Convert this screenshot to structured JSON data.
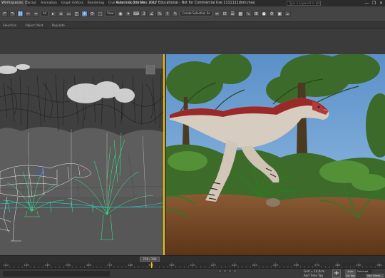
{
  "window": {
    "workspace": "Workspaces: Default",
    "title": "Autodesk 3ds Max 2017 Educational - Not for Commercial Use   1111111dnm.max",
    "search_placeholder": "Type a keyword or phrase",
    "controls": [
      "—",
      "❐",
      "✕"
    ]
  },
  "menu": [
    "Script",
    "Animation",
    "Graph Editors",
    "Rendering",
    "Civil View",
    "Customize",
    "Help"
  ],
  "toolbar": {
    "filter_value": "All",
    "view_value": "View",
    "selection_set_placeholder": "Create Selection Se",
    "ribbon_tabs": [
      "Populate"
    ]
  },
  "command_strip": [
    "Selection",
    "Object Paint",
    "Populate"
  ],
  "viewports": {
    "left": {
      "mode": "wireframe"
    },
    "right": {
      "mode": "shaded"
    }
  },
  "timeline": {
    "slider_label": "238 / 300",
    "ruler": [
      "120",
      "130",
      "140",
      "150",
      "160",
      "170",
      "180",
      "190",
      "200",
      "210",
      "220",
      "230",
      "240",
      "250",
      "260",
      "270",
      "280",
      "290",
      "300"
    ]
  },
  "status": {
    "grid": "Grid = 10,0cm",
    "add_time_tag": "Add Time Tag",
    "auto_key": "Auto Key",
    "set_key": "Set Key",
    "selected": "Selected",
    "key_filters": "Key Filters..."
  },
  "colors": {
    "accent_yellow": "#f0c000",
    "wire_cyan": "#22e0e0",
    "wire_white": "#ffffff",
    "wire_green": "#33ff88",
    "sky": "#6fa3d6",
    "dirt": "#7a4a2a"
  }
}
